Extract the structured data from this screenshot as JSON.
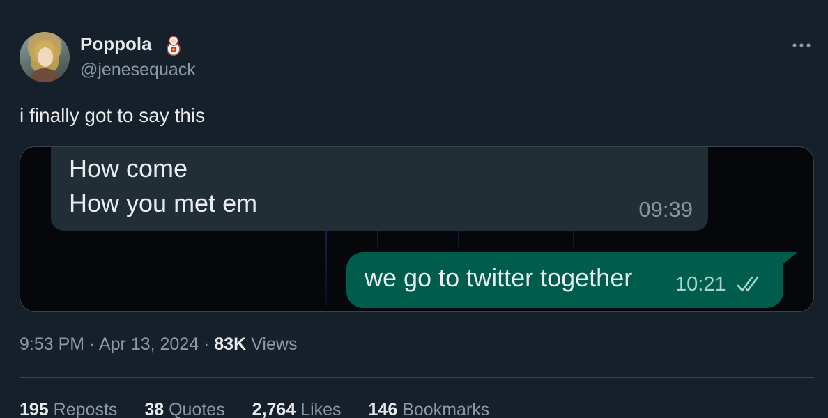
{
  "tweet": {
    "display_name": "Poppola",
    "handle": "@jenesequack",
    "name_badge_icon": "nesting-doll-icon",
    "more_icon": "more-horizontal-icon",
    "text": "i finally got to say this",
    "timestamp": "9:53 PM",
    "separator": "·",
    "date": "Apr 13, 2024",
    "views_count": "83K",
    "views_label": "Views"
  },
  "media": {
    "incoming_bubble": {
      "lines": [
        "How come",
        "How you met em"
      ],
      "time": "09:39"
    },
    "outgoing_bubble": {
      "text": "we go to twitter together",
      "time": "10:21",
      "status_icon": "double-check-icon"
    },
    "colors": {
      "incoming_bg": "#222e35",
      "outgoing_bg": "#005c4b",
      "backdrop": "#05070a"
    }
  },
  "stats": [
    {
      "count": "195",
      "label": "Reposts"
    },
    {
      "count": "38",
      "label": "Quotes"
    },
    {
      "count": "2,764",
      "label": "Likes"
    },
    {
      "count": "146",
      "label": "Bookmarks"
    }
  ],
  "theme": {
    "background": "#15202b",
    "primary_text": "#e7e9ea",
    "secondary_text": "#8b98a5",
    "border": "#38444d"
  }
}
